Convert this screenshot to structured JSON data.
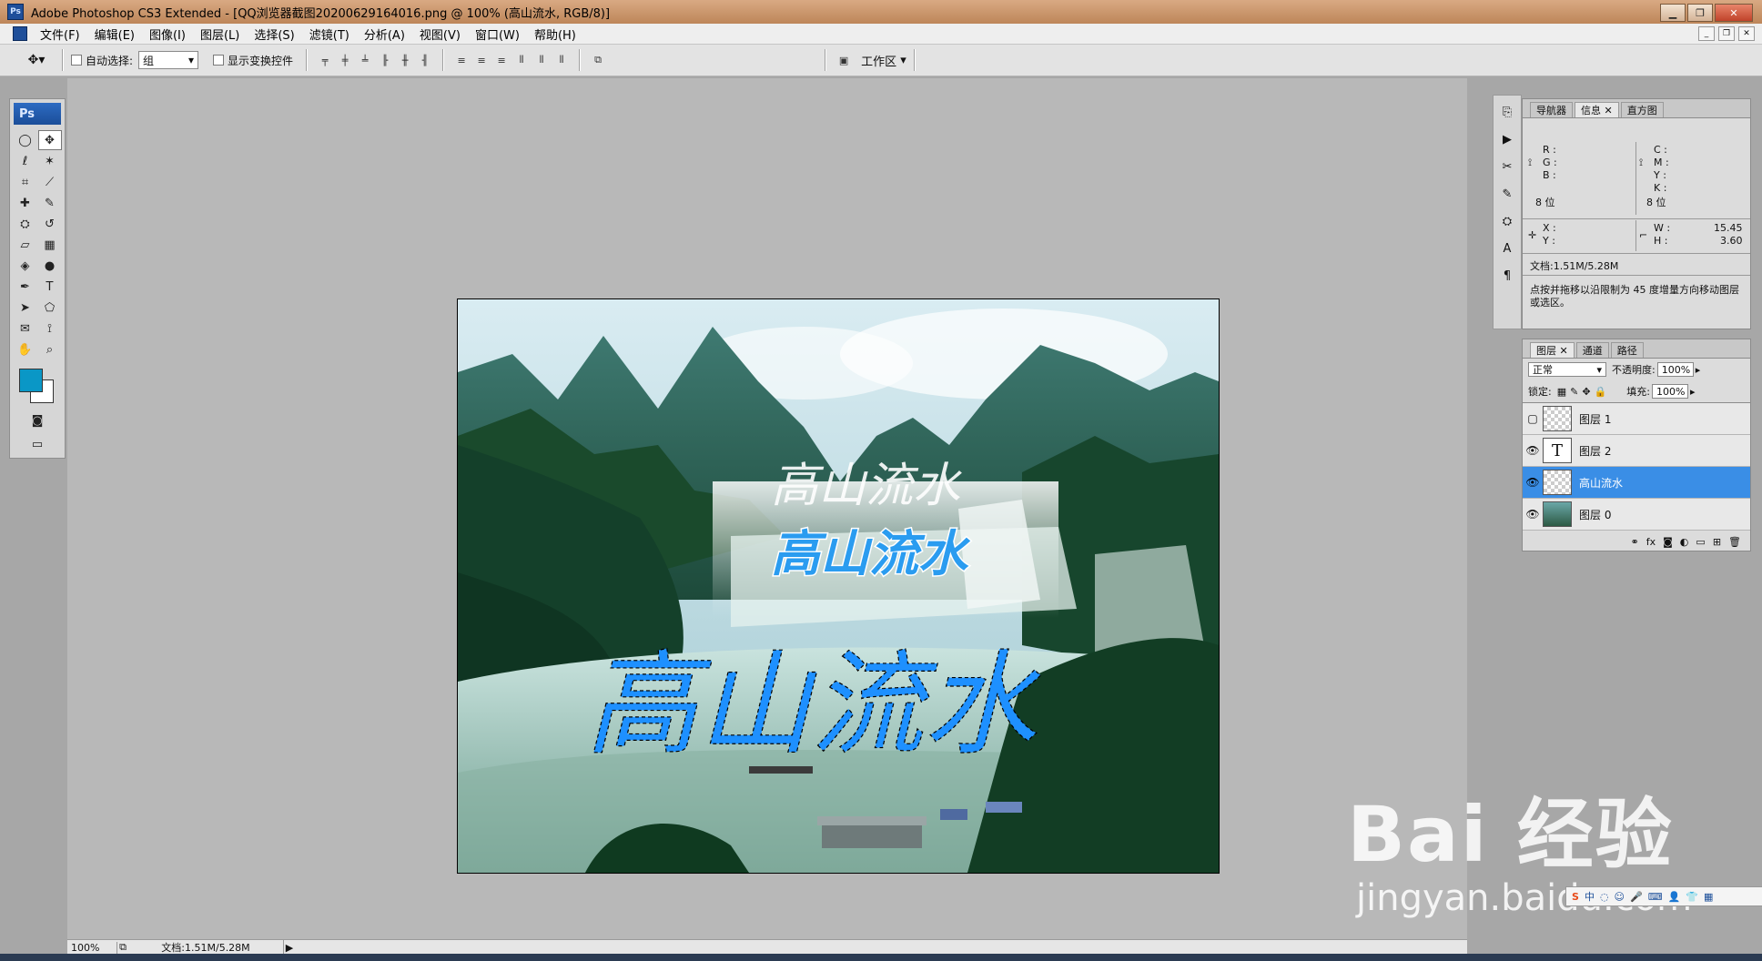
{
  "window": {
    "title": "Adobe Photoshop CS3 Extended - [QQ浏览器截图20200629164016.png @ 100% (高山流水, RGB/8)]",
    "ps_badge": "Ps"
  },
  "menu": [
    "文件(F)",
    "编辑(E)",
    "图像(I)",
    "图层(L)",
    "选择(S)",
    "滤镜(T)",
    "分析(A)",
    "视图(V)",
    "窗口(W)",
    "帮助(H)"
  ],
  "options": {
    "auto_select_label": "自动选择:",
    "auto_select_value": "组",
    "show_transform_label": "显示变换控件",
    "workspace_label": "工作区"
  },
  "toolbox": {
    "title": "Ps",
    "tools": [
      "marquee-icon",
      "move-icon",
      "lasso-icon",
      "magic-wand-icon",
      "crop-icon",
      "slice-icon",
      "healing-icon",
      "brush-icon",
      "stamp-icon",
      "history-brush-icon",
      "eraser-icon",
      "gradient-icon",
      "blur-icon",
      "dodge-icon",
      "pen-icon",
      "type-icon",
      "path-select-icon",
      "shape-icon",
      "notes-icon",
      "eyedropper-icon",
      "hand-icon",
      "zoom-icon"
    ],
    "fg_color": "#0a97c6",
    "bg_color": "#ffffff"
  },
  "document": {
    "texts": [
      "高山流水",
      "高山流水",
      "高山流水"
    ],
    "text_colors": {
      "white": "#ffffff",
      "blue": "#1e90ff"
    }
  },
  "status": {
    "zoom": "100%",
    "doc": "文档:1.51M/5.28M"
  },
  "info_panel": {
    "tabs": [
      "导航器",
      "信息",
      "直方图"
    ],
    "active_tab": "信息",
    "rgb": {
      "r": "R :",
      "g": "G :",
      "b": "B :"
    },
    "cmyk": {
      "c": "C :",
      "m": "M :",
      "y": "Y :",
      "k": "K :"
    },
    "bit_left": "8 位",
    "bit_right": "8 位",
    "x_label": "X :",
    "y_label": "Y :",
    "w_label": "W :",
    "h_label": "H :",
    "w_value": "15.45",
    "h_value": "3.60",
    "doc": "文档:1.51M/5.28M",
    "hint": "点按并拖移以沿限制为 45 度增量方向移动图层或选区。"
  },
  "layers_panel": {
    "tabs": [
      "图层",
      "通道",
      "路径"
    ],
    "active_tab": "图层",
    "blend_mode": "正常",
    "opacity_label": "不透明度:",
    "opacity": "100%",
    "lock_label": "锁定:",
    "fill_label": "填充:",
    "fill": "100%",
    "layers": [
      {
        "name": "图层 1",
        "visible": false,
        "thumb": "transparent"
      },
      {
        "name": "图层 2",
        "visible": true,
        "thumb": "text"
      },
      {
        "name": "高山流水",
        "visible": true,
        "thumb": "transparent",
        "selected": true
      },
      {
        "name": "图层 0",
        "visible": true,
        "thumb": "image"
      }
    ]
  },
  "watermark": {
    "logo": "Bai 经验",
    "url": "jingyan.baidu.com"
  }
}
